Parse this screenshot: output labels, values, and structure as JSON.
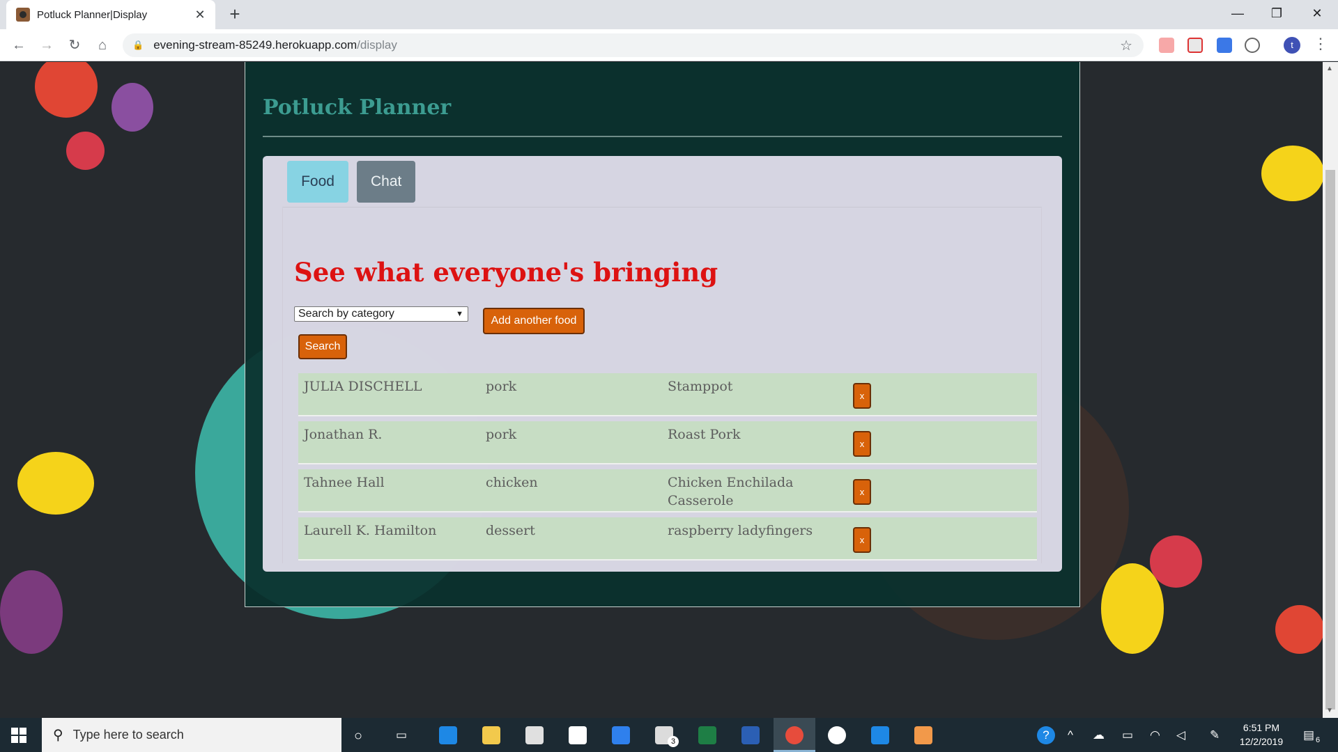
{
  "browser": {
    "tab_title": "Potluck Planner|Display",
    "tab_close": "✕",
    "new_tab": "+",
    "url_host": "evening-stream-85249.herokuapp.com",
    "url_path": "/display",
    "profile_initial": "t",
    "window_controls": {
      "minimize": "—",
      "maximize": "❐",
      "close": "✕"
    }
  },
  "page": {
    "site_title": "Potluck Planner",
    "tabs": [
      {
        "label": "Food",
        "active": true
      },
      {
        "label": "Chat",
        "active": false
      }
    ],
    "heading": "See what everyone's bringing",
    "category_select": {
      "selected": "Search by category"
    },
    "add_button": "Add another food",
    "search_button": "Search",
    "delete_label": "x",
    "foods": [
      {
        "name": "JULIA DISCHELL",
        "category": "pork",
        "dish": "Stamppot"
      },
      {
        "name": "Jonathan R.",
        "category": "pork",
        "dish": "Roast Pork"
      },
      {
        "name": "Tahnee Hall",
        "category": "chicken",
        "dish": "Chicken Enchilada Casserole"
      },
      {
        "name": "Laurell K. Hamilton",
        "category": "dessert",
        "dish": "raspberry ladyfingers"
      }
    ]
  },
  "taskbar": {
    "search_placeholder": "Type here to search",
    "clock_time": "6:51 PM",
    "clock_date": "12/2/2019",
    "mail_badge": "3",
    "notification_badge": "6"
  },
  "colors": {
    "accent_teal": "#3c9c91",
    "heading_red": "#dd1212",
    "button_orange": "#d8620a",
    "tab_food": "#87d3e3",
    "tab_chat": "#6c7d88"
  }
}
